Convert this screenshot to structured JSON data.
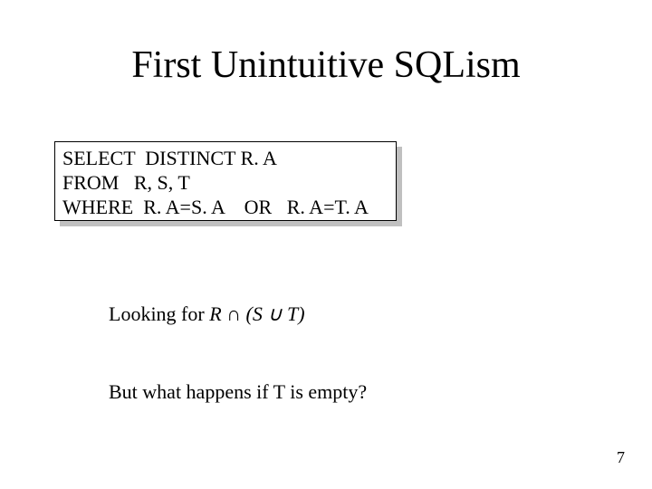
{
  "title": "First Unintuitive SQLism",
  "sql": {
    "line1": "SELECT  DISTINCT R. A",
    "line2": "FROM   R, S, T",
    "line3": "WHERE  R. A=S. A    OR   R. A=T. A"
  },
  "looking_label": "Looking for  ",
  "formula": "R ∩ (S ∪ T)",
  "question": "But what happens if T is empty?",
  "page_number": "7"
}
